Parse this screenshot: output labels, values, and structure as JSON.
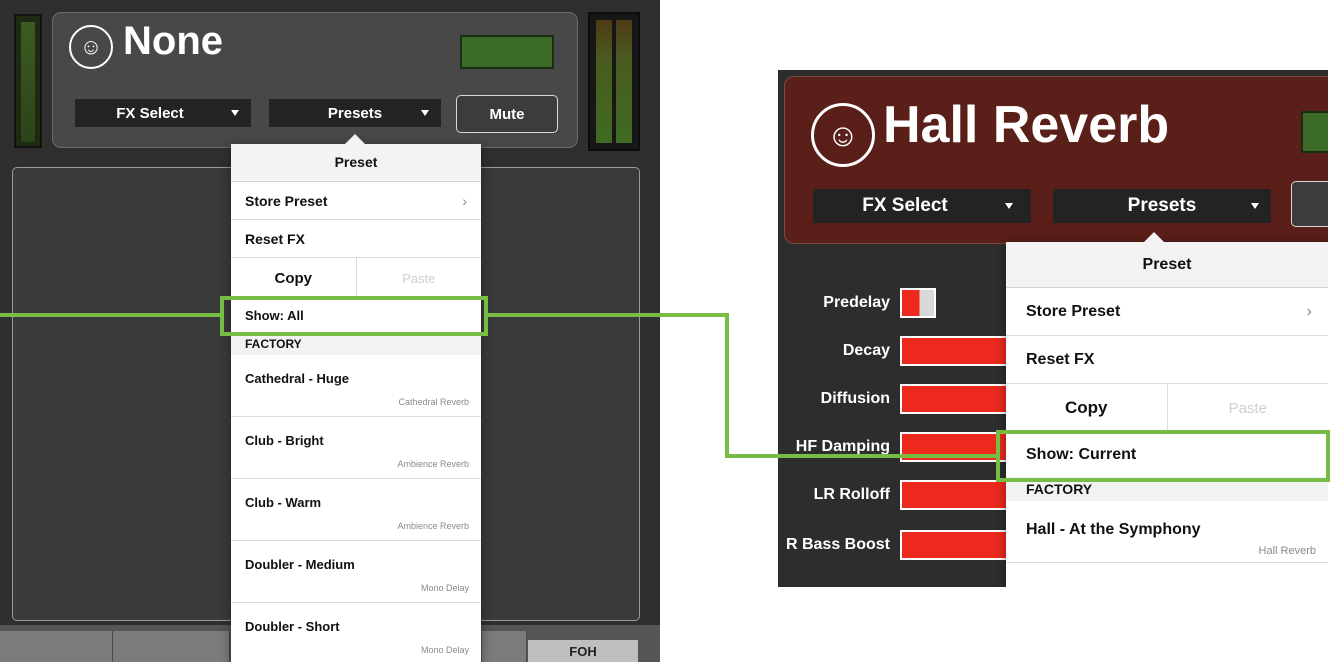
{
  "left": {
    "fx_name": "None",
    "fx_select_label": "FX Select",
    "presets_label": "Presets",
    "mute_label": "Mute",
    "foh_label": "FOH",
    "popover": {
      "title": "Preset",
      "store_preset": "Store Preset",
      "chevron": "›",
      "reset_fx": "Reset FX",
      "copy": "Copy",
      "paste": "Paste",
      "show": "Show: All",
      "section": "FACTORY",
      "presets": [
        {
          "name": "Cathedral - Huge",
          "type": "Cathedral Reverb"
        },
        {
          "name": "Club - Bright",
          "type": "Ambience Reverb"
        },
        {
          "name": "Club - Warm",
          "type": "Ambience Reverb"
        },
        {
          "name": "Doubler - Medium",
          "type": "Mono Delay"
        },
        {
          "name": "Doubler - Short",
          "type": "Mono Delay"
        }
      ]
    }
  },
  "right": {
    "fx_name": "Hall Reverb",
    "fx_select_label": "FX Select",
    "presets_label": "Presets",
    "params": [
      {
        "label": "Predelay",
        "level": 0.05
      },
      {
        "label": "Decay",
        "level": 1.0
      },
      {
        "label": "Diffusion",
        "level": 1.0
      },
      {
        "label": "HF Damping",
        "level": 1.0
      },
      {
        "label": "LR Rolloff",
        "level": 1.0
      },
      {
        "label": "R Bass Boost",
        "level": 1.0
      }
    ],
    "popover": {
      "title": "Preset",
      "store_preset": "Store Preset",
      "chevron": "›",
      "reset_fx": "Reset FX",
      "copy": "Copy",
      "paste": "Paste",
      "show": "Show: Current",
      "section": "FACTORY",
      "presets": [
        {
          "name": "Hall - At the Symphony",
          "type": "Hall Reverb"
        }
      ]
    }
  },
  "colors": {
    "highlight": "#77bd44",
    "param_bar": "#ee2a1e",
    "right_header": "#5a1f18"
  },
  "icons": {
    "logo": "mackie-running-man-icon",
    "dropdown": "caret-down-icon",
    "submenu": "chevron-right-icon"
  }
}
